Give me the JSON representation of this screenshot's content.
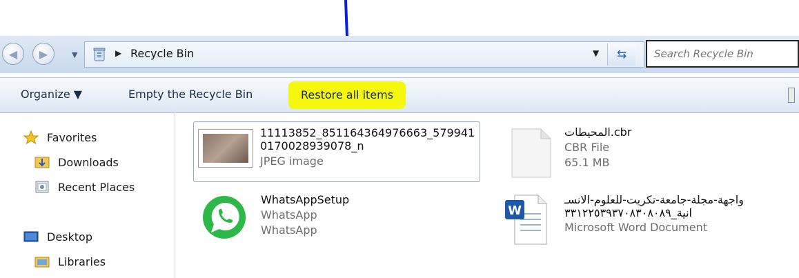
{
  "address_bar": {
    "path_label": "Recycle Bin",
    "search_placeholder": "Search Recycle Bin"
  },
  "toolbar": {
    "organize_label": "Organize ▼",
    "empty_label": "Empty the Recycle Bin",
    "restore_label": "Restore all items",
    "restore_highlight_color": "#f5f70f"
  },
  "navigation": {
    "favorites_label": "Favorites",
    "downloads_label": "Downloads",
    "recent_places_label": "Recent Places",
    "desktop_label": "Desktop",
    "libraries_label": "Libraries"
  },
  "files": [
    {
      "name_line1": "11113852_851164364976663_579941",
      "name_line2": "0170028939078_n",
      "type": "JPEG image",
      "size": ""
    },
    {
      "name_line1": "المحيطات.cbr",
      "name_line2": "",
      "type": "CBR File",
      "size": "65.1 MB"
    },
    {
      "name_line1": "WhatsAppSetup",
      "name_line2": "",
      "type": "WhatsApp",
      "size": "WhatsApp"
    },
    {
      "name_line1": "واجهة-مجلة-جامعة-تكريت-للعلوم-الانسـ",
      "name_line2": "انية_٣٣١٢٢٥٣٩٣٧٠٨٣٠٨٠٨٩",
      "type": "Microsoft Word Document",
      "size": ""
    }
  ],
  "colors": {
    "annotation_arrow": "#0a1fd6",
    "accent": "#1f5fb8"
  }
}
